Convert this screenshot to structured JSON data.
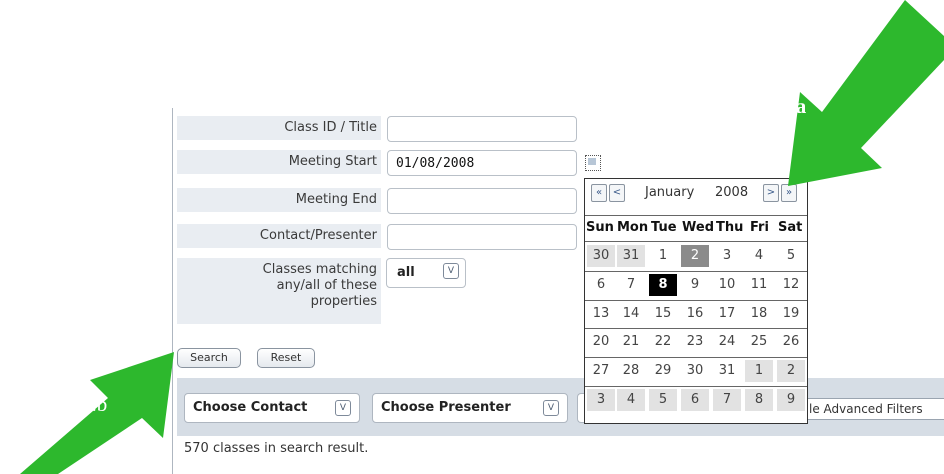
{
  "form": {
    "fields": [
      {
        "label": "Class ID / Title",
        "value": ""
      },
      {
        "label": "Meeting Start",
        "value": "01/08/2008"
      },
      {
        "label": "Meeting End",
        "value": ""
      },
      {
        "label": "Contact/Presenter",
        "value": ""
      }
    ],
    "matching": {
      "label_lines": [
        "Classes matching",
        "any/all of these",
        "properties"
      ],
      "selected": "all"
    },
    "search_label": "Search",
    "reset_label": "Reset"
  },
  "filters": {
    "contact_label": "Choose Contact",
    "presenter_label": "Choose Presenter",
    "advanced_label": "le Advanced Filters",
    "dropdown_arrow": "V"
  },
  "result_text": "570 classes in search result.",
  "calendar": {
    "month": "January",
    "year": "2008",
    "nav": {
      "prev_year": "«",
      "prev_month": "<",
      "next_month": ">",
      "next_year": "»"
    },
    "weekdays": [
      "Sun",
      "Mon",
      "Tue",
      "Wed",
      "Thu",
      "Fri",
      "Sat"
    ],
    "weeks": [
      [
        "30",
        "31",
        "1",
        "2",
        "3",
        "4",
        "5"
      ],
      [
        "6",
        "7",
        "8",
        "9",
        "10",
        "11",
        "12"
      ],
      [
        "13",
        "14",
        "15",
        "16",
        "17",
        "18",
        "19"
      ],
      [
        "20",
        "21",
        "22",
        "23",
        "24",
        "25",
        "26"
      ],
      [
        "27",
        "28",
        "29",
        "30",
        "31",
        "1",
        "2"
      ],
      [
        "3",
        "4",
        "5",
        "6",
        "7",
        "8",
        "9"
      ]
    ],
    "selected_day": "8",
    "today_day": "2"
  },
  "annotations": {
    "a": "9.a",
    "b": "9.b"
  },
  "colors": {
    "arrow": "#2db82d",
    "panel": "#e9edf2",
    "filter_bar": "#d6dde5"
  }
}
